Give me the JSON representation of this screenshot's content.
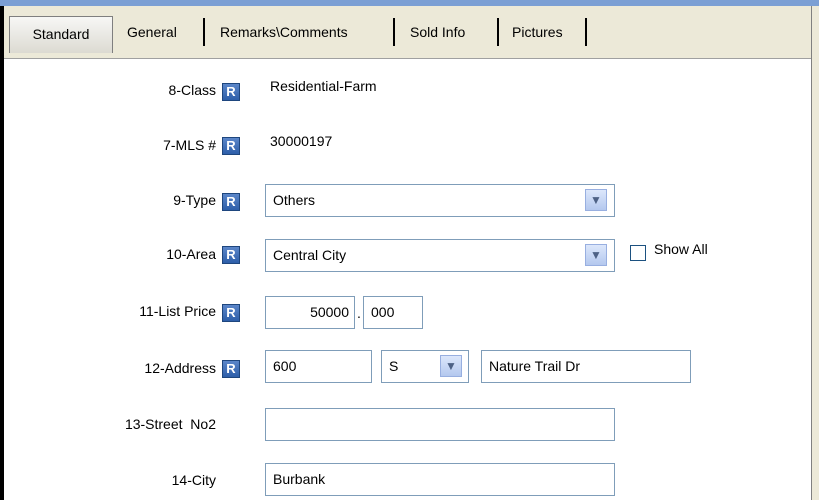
{
  "tabs": [
    {
      "label": "Standard"
    },
    {
      "label": "General"
    },
    {
      "label": "Remarks\\Comments"
    },
    {
      "label": "Sold Info"
    },
    {
      "label": "Pictures"
    }
  ],
  "required_icon_letter": "R",
  "fields": {
    "class": {
      "label": "8-Class",
      "value": "Residential-Farm"
    },
    "mls": {
      "label": "7-MLS #",
      "value": "30000197"
    },
    "type": {
      "label": "9-Type",
      "value": "Others"
    },
    "area": {
      "label": "10-Area",
      "value": "Central City",
      "show_all_label": "Show All"
    },
    "list_price": {
      "label": "11-List Price",
      "dollars": "50000",
      "separator": ".",
      "cents": "000"
    },
    "address": {
      "label": "12-Address",
      "number": "600",
      "direction": "S",
      "street": "Nature Trail Dr"
    },
    "street_no2": {
      "label": "13-Street  No2",
      "value": ""
    },
    "city": {
      "label": "14-City",
      "value": "Burbank"
    }
  },
  "icons": {
    "required": "required-r-icon",
    "dropdown": "chevron-down-icon",
    "checkbox": "checkbox-icon"
  }
}
